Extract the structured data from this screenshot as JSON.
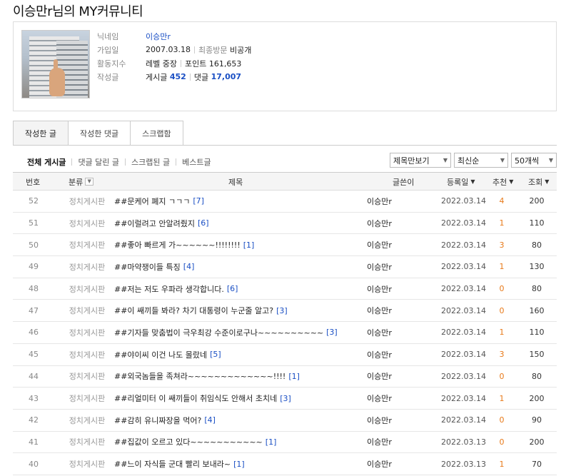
{
  "page": {
    "title": "이승만r님의 MY커뮤니티"
  },
  "profile": {
    "labels": {
      "nickname": "닉네임",
      "joined": "가입일",
      "activity": "활동지수",
      "posts": "작성글"
    },
    "nickname": "이승만r",
    "joined_date": "2007.03.18",
    "last_visit_label": "최종방문",
    "last_visit_value": "비공개",
    "level": "레벨 중장",
    "points": "포인트 161,653",
    "posts_label": "게시글",
    "posts_count": "452",
    "comments_label": "댓글",
    "comments_count": "17,007"
  },
  "tabs": [
    {
      "label": "작성한 글",
      "active": true
    },
    {
      "label": "작성한 댓글",
      "active": false
    },
    {
      "label": "스크랩함",
      "active": false
    }
  ],
  "filters": [
    "전체 게시글",
    "댓글 달린 글",
    "스크랩된 글",
    "베스트글"
  ],
  "selects": {
    "view": "제목만보기",
    "sort": "최신순",
    "count": "50개씩"
  },
  "columns": {
    "num": "번호",
    "category": "분류",
    "title": "제목",
    "author": "글쓴이",
    "date": "등록일",
    "recommend": "추천",
    "views": "조회"
  },
  "rows": [
    {
      "num": "52",
      "category": "정치게시판",
      "title": "##문케어 폐지 ㄱㄱㄱ",
      "comments": "[7]",
      "author": "이승만r",
      "date": "2022.03.14",
      "rec": "4",
      "views": "200"
    },
    {
      "num": "51",
      "category": "정치게시판",
      "title": "##이럴려고 안알려줬지",
      "comments": "[6]",
      "author": "이승만r",
      "date": "2022.03.14",
      "rec": "1",
      "views": "110"
    },
    {
      "num": "50",
      "category": "정치게시판",
      "title": "##좋아 빠르게 가~~~~~~!!!!!!!!",
      "comments": "[1]",
      "author": "이승만r",
      "date": "2022.03.14",
      "rec": "3",
      "views": "80"
    },
    {
      "num": "49",
      "category": "정치게시판",
      "title": "##마약쟁이들 특징",
      "comments": "[4]",
      "author": "이승만r",
      "date": "2022.03.14",
      "rec": "1",
      "views": "130"
    },
    {
      "num": "48",
      "category": "정치게시판",
      "title": "##저는 저도 우파라 생각합니다.",
      "comments": "[6]",
      "author": "이승만r",
      "date": "2022.03.14",
      "rec": "0",
      "views": "80"
    },
    {
      "num": "47",
      "category": "정치게시판",
      "title": "##이 쌔끼들 봐라? 차기 대통령이 누군줄 알고?",
      "comments": "[3]",
      "author": "이승만r",
      "date": "2022.03.14",
      "rec": "0",
      "views": "160"
    },
    {
      "num": "46",
      "category": "정치게시판",
      "title": "##기자들 맞춤법이 극우최강 수준이로구나~~~~~~~~~~",
      "comments": "[3]",
      "author": "이승만r",
      "date": "2022.03.14",
      "rec": "1",
      "views": "110"
    },
    {
      "num": "45",
      "category": "정치게시판",
      "title": "##야이씨 이건 나도 몰랐네",
      "comments": "[5]",
      "author": "이승만r",
      "date": "2022.03.14",
      "rec": "3",
      "views": "150"
    },
    {
      "num": "44",
      "category": "정치게시판",
      "title": "##외국놈들을 족쳐라~~~~~~~~~~~~~!!!!",
      "comments": "[1]",
      "author": "이승만r",
      "date": "2022.03.14",
      "rec": "0",
      "views": "80"
    },
    {
      "num": "43",
      "category": "정치게시판",
      "title": "##리얼미터 이 쌔끼들이 취임식도 안해서 초치네",
      "comments": "[3]",
      "author": "이승만r",
      "date": "2022.03.14",
      "rec": "1",
      "views": "200"
    },
    {
      "num": "42",
      "category": "정치게시판",
      "title": "##감히 유니짜장을 먹어?",
      "comments": "[4]",
      "author": "이승만r",
      "date": "2022.03.14",
      "rec": "0",
      "views": "90"
    },
    {
      "num": "41",
      "category": "정치게시판",
      "title": "##집값이 오르고 있다~~~~~~~~~~~",
      "comments": "[1]",
      "author": "이승만r",
      "date": "2022.03.13",
      "rec": "0",
      "views": "200"
    },
    {
      "num": "40",
      "category": "정치게시판",
      "title": "##느이 자식들 군대 빨리 보내라~",
      "comments": "[1]",
      "author": "이승만r",
      "date": "2022.03.13",
      "rec": "1",
      "views": "70"
    }
  ]
}
